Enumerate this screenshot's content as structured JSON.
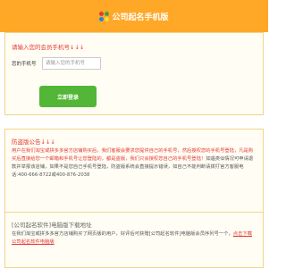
{
  "header": {
    "title": "公司起名手机版",
    "logo_icon": "colorful-flower-logo"
  },
  "login": {
    "title": "请输入您的会员手机号↓↓↓",
    "phone_label": "您的手机号",
    "phone_placeholder": "请输入您的手机号",
    "phone_value": "",
    "submit_label": "立即登录"
  },
  "notice": {
    "title": "防盗版公告↓↓↓",
    "red_text": "用户在我们淘宝或拼多多官方店铺购买后，我们客服会要求您提供自己的手机号，然后授权您的手机号登陆，凡是购买后直接给您一个邮箱和手机号让您登陆的，都是盗版，我们只会授权您自己的手机号登陆！",
    "gray_text": "如遇类似情况可申请退款并举报该店铺，如果不是您自己手机号登陆，防盗版系统会直接提示错误，如自己不能判断请拨打官方客服电话:400-666-8722或400-876-2038"
  },
  "download": {
    "title": "[公司起名软件]电脑版下载地址",
    "text": "在我们淘宝或拼多多官方店铺购买了网页版的用户，好评后可获赠[公司起名软件]电脑版会员序列号一个，",
    "link_label": "点击下载公司起名软件电脑版"
  },
  "colors": {
    "header_bg": "#ffa827",
    "accent_red": "#e53935",
    "button_green": "#53b637"
  }
}
